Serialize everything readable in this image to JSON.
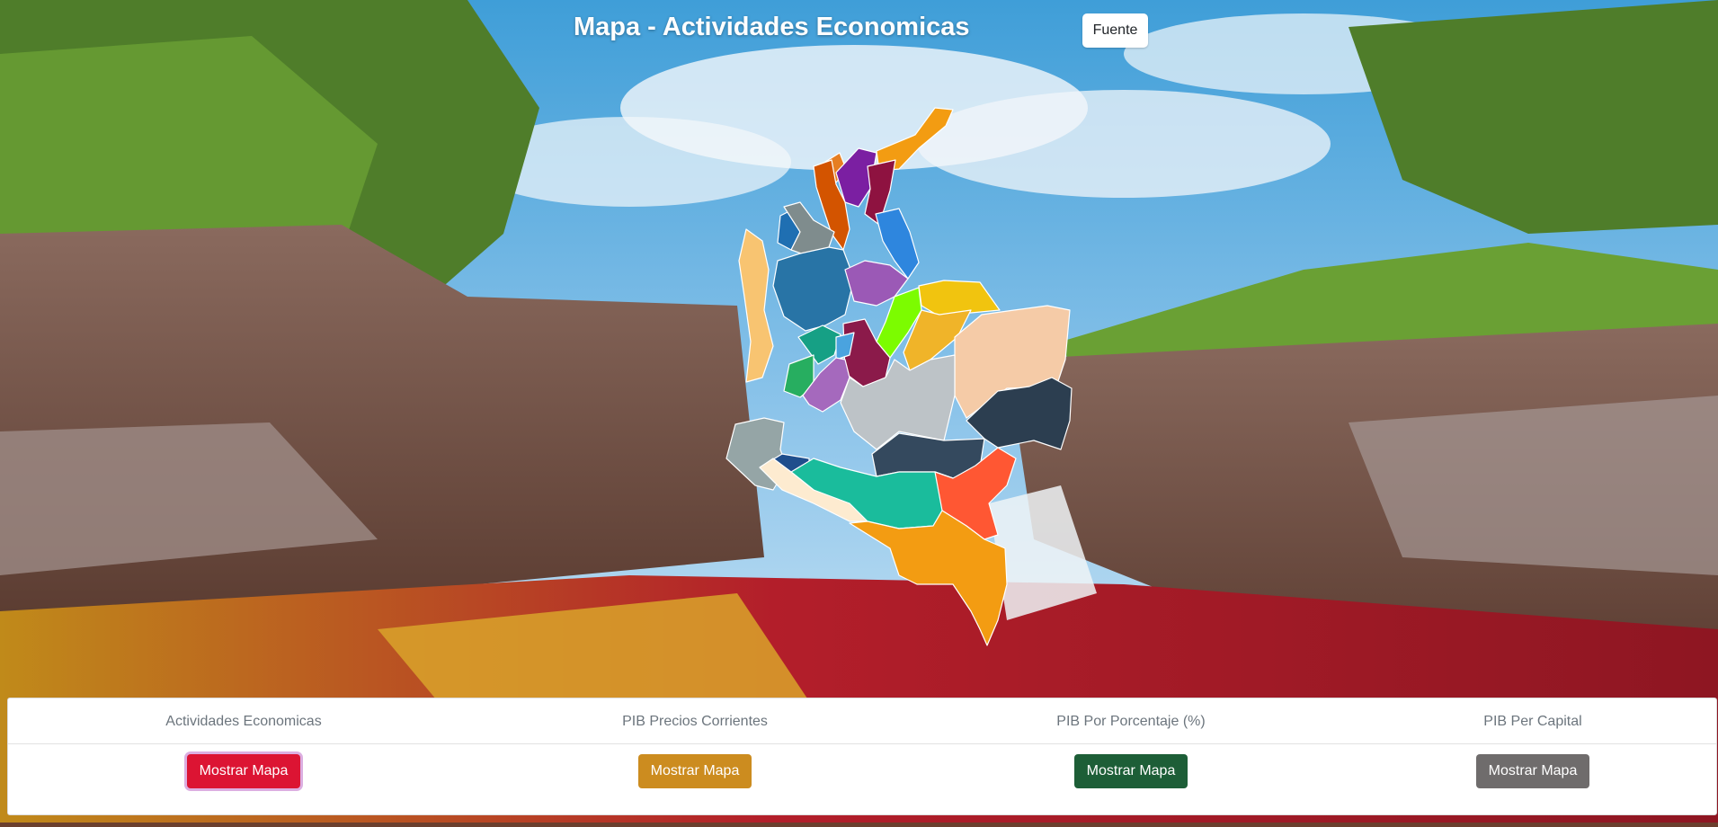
{
  "header": {
    "title": "Mapa - Actividades Economicas",
    "source_button_label": "Fuente"
  },
  "map": {
    "department_colors": [
      "#f39c12",
      "#e67e22",
      "#7b1fa2",
      "#8e1240",
      "#d35400",
      "#2e86de",
      "#1f6fb2",
      "#7f8c8d",
      "#f8c471",
      "#2874a6",
      "#9b59b6",
      "#f1c40f",
      "#7cfc00",
      "#f0b429",
      "#8b1a4a",
      "#16a085",
      "#27ae60",
      "#4aa3df",
      "#a569bd",
      "#f5cba7",
      "#bdc3c7",
      "#2c3e50",
      "#34495e",
      "#95a5a6",
      "#1f4e8c",
      "#1abc9c",
      "#fdebd0",
      "#ff5733"
    ]
  },
  "panel": {
    "columns": [
      {
        "label": "Actividades Economicas",
        "button": "Mostrar Mapa",
        "color": "#dc1433"
      },
      {
        "label": "PIB Precios Corrientes",
        "button": "Mostrar Mapa",
        "color": "#cc8c1f"
      },
      {
        "label": "PIB Por Porcentaje (%)",
        "button": "Mostrar Mapa",
        "color": "#1d5e37"
      },
      {
        "label": "PIB Per Capital",
        "button": "Mostrar Mapa",
        "color": "#6f6c6c"
      }
    ]
  }
}
